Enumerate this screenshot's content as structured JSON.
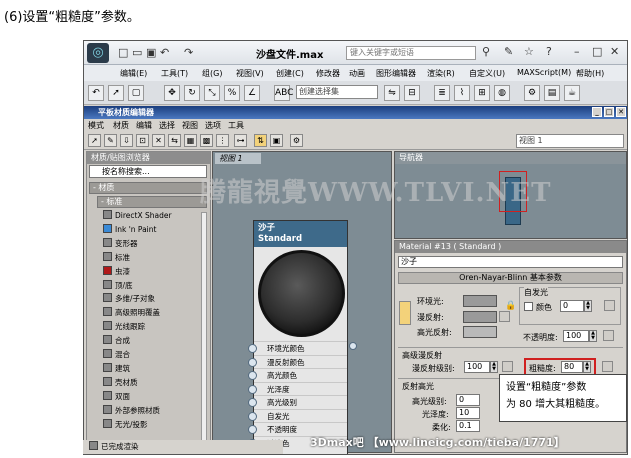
{
  "caption": "(6)设置“粗糙度”参数。",
  "app": {
    "title": "沙盘文件.max",
    "search_placeholder": "键入关键字或短语",
    "menu": [
      "编辑(E)",
      "工具(T)",
      "组(G)",
      "视图(V)",
      "创建(C)",
      "修改器",
      "动画",
      "图形编辑器",
      "渲染(R)",
      "自定义(U)",
      "MAXScript(M)",
      "帮助(H)"
    ],
    "selection_set": "创建选择集"
  },
  "sme": {
    "title": "平板材质编辑器",
    "menu": [
      "模式",
      "材质",
      "编辑",
      "选择",
      "视图",
      "选项",
      "工具"
    ],
    "view_combo": "视图 1",
    "browser_title": "材质/贴图浏览器",
    "search": "按名称搜索...",
    "group_materials": "- 材质",
    "group_standard": "- 标准",
    "materials": [
      {
        "name": "DirectX Shader",
        "color": "#888888"
      },
      {
        "name": "Ink 'n Paint",
        "color": "#3a8ad6"
      },
      {
        "name": "变形器",
        "color": "#888888"
      },
      {
        "name": "标准",
        "color": "#888888"
      },
      {
        "name": "虫漆",
        "color": "#b01818"
      },
      {
        "name": "顶/底",
        "color": "#888888"
      },
      {
        "name": "多维/子对象",
        "color": "#888888"
      },
      {
        "name": "高级照明覆盖",
        "color": "#888888"
      },
      {
        "name": "光线跟踪",
        "color": "#888888"
      },
      {
        "name": "合成",
        "color": "#888888"
      },
      {
        "name": "混合",
        "color": "#888888"
      },
      {
        "name": "建筑",
        "color": "#888888"
      },
      {
        "name": "壳材质",
        "color": "#888888"
      },
      {
        "name": "双面",
        "color": "#888888"
      },
      {
        "name": "外部参照材质",
        "color": "#888888"
      },
      {
        "name": "无光/投影",
        "color": "#888888"
      }
    ],
    "view_tab": "视图 1",
    "node": {
      "name": "沙子",
      "type": "Standard",
      "slots": [
        "环境光颜色",
        "漫反射颜色",
        "高光颜色",
        "光泽度",
        "高光级别",
        "自发光",
        "不透明度",
        "过滤色"
      ]
    },
    "navigator_title": "导航器",
    "props": {
      "header": "Material #13 ( Standard )",
      "name": "沙子",
      "rollout_basic": "Oren-Nayar-Blinn 基本参数",
      "self_illum": "自发光",
      "color_label": "颜色",
      "self_illum_value": "0",
      "ambient": "环境光:",
      "diffuse": "漫反射:",
      "specular": "高光反射:",
      "opacity_label": "不透明度:",
      "opacity_value": "100",
      "adv_diffuse": "高级漫反射",
      "diffuse_level_label": "漫反射级别:",
      "diffuse_level": "100",
      "roughness_label": "粗糙度:",
      "roughness": "80",
      "spec_hl": "反射高光",
      "spec_level_label": "高光级别:",
      "spec_level": "0",
      "gloss_label": "光泽度:",
      "gloss": "10",
      "soften_label": "柔化:",
      "soften": "0.1"
    },
    "status": "已完成渲染"
  },
  "callout_line1": "设置“粗糙度”参数",
  "callout_line2": "为 80 增大其粗糙度。",
  "watermark": "腾龍視覺WWW.TLVI.NET",
  "bottom_watermark": "3Dmax吧 【www.lineicg.com/tieba/1771】",
  "colors": {
    "title_blue": "#1b3e7e",
    "node_header": "#3e6a8a",
    "highlight_red": "#d02020"
  }
}
